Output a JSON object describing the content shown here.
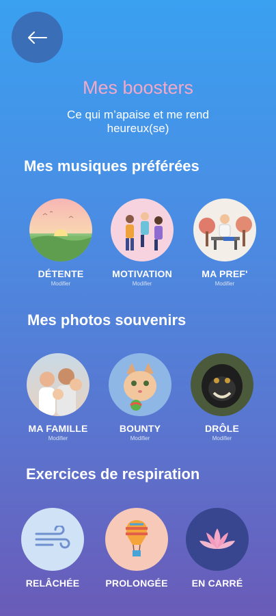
{
  "header": {
    "title": "Mes boosters",
    "subtitle": "Ce qui m’apaise et me rend heureux(se)"
  },
  "music": {
    "title": "Mes musiques préférées",
    "items": [
      {
        "label": "DÉTENTE",
        "edit": "Modifier"
      },
      {
        "label": "MOTIVATION",
        "edit": "Modifier"
      },
      {
        "label": "MA PREF'",
        "edit": "Modifier"
      }
    ]
  },
  "photos": {
    "title": "Mes photos souvenirs",
    "items": [
      {
        "label": "MA FAMILLE",
        "edit": "Modifier"
      },
      {
        "label": "BOUNTY",
        "edit": "Modifier"
      },
      {
        "label": "DRÔLE",
        "edit": "Modifier"
      }
    ]
  },
  "breathing": {
    "title": "Exercices de respiration",
    "items": [
      {
        "label": "RELÂCHÉE",
        "icon": "wind-icon",
        "bg": "#cfe2f6"
      },
      {
        "label": "PROLONGÉE",
        "icon": "hot-air-balloon-icon",
        "bg": "#f6c9b8"
      },
      {
        "label": "EN CARRÉ",
        "icon": "lotus-icon",
        "bg": "#37468f"
      }
    ]
  },
  "colors": {
    "accent_title": "#f2a9c8",
    "back_button": "#3a6fb8"
  }
}
